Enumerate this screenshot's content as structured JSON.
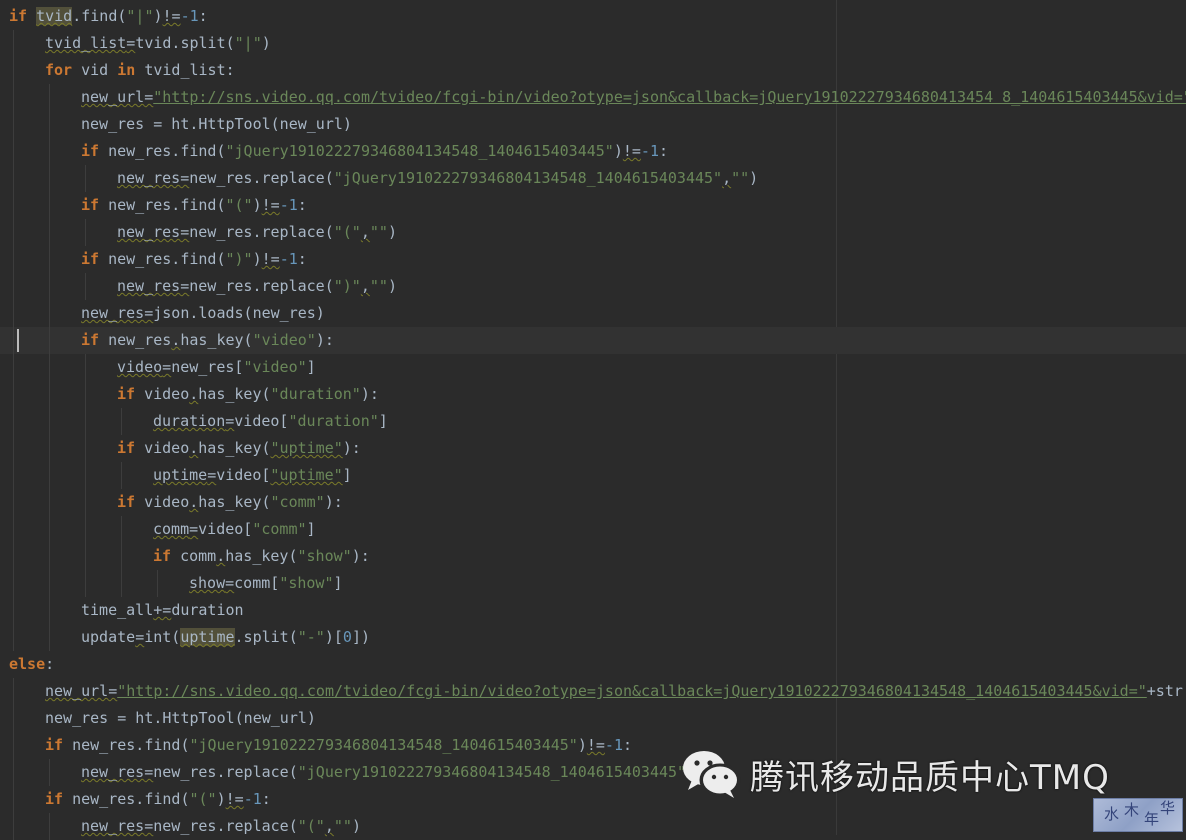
{
  "editor": {
    "caret_line": 12,
    "lines": [
      {
        "indent": 0,
        "tokens": [
          [
            "kw",
            "if"
          ],
          [
            "op",
            " "
          ],
          [
            "hl wav",
            "tvid"
          ],
          [
            "op",
            ".find("
          ],
          [
            "str",
            "\"|\""
          ],
          [
            "op",
            ")"
          ],
          [
            "wav",
            "!="
          ],
          [
            "num",
            "-1"
          ],
          [
            "op",
            ":"
          ]
        ]
      },
      {
        "indent": 1,
        "tokens": [
          [
            "wav",
            "tvid_list"
          ],
          [
            "wav",
            "="
          ],
          [
            "op",
            "tvid.split("
          ],
          [
            "str",
            "\"|\""
          ],
          [
            "op",
            ")"
          ]
        ]
      },
      {
        "indent": 1,
        "tokens": [
          [
            "kw",
            "for"
          ],
          [
            "op",
            " vid "
          ],
          [
            "kw",
            "in"
          ],
          [
            "op",
            " tvid_list:"
          ]
        ]
      },
      {
        "indent": 2,
        "tokens": [
          [
            "wav",
            "new_url"
          ],
          [
            "wav",
            "="
          ],
          [
            "str link",
            "\"http://sns.video.qq.com/tvideo/fcgi-bin/video?otype=json&callback=jQuery19102227934680413454 8_1404615403445&vid=\""
          ],
          [
            "op",
            "+"
          ]
        ]
      },
      {
        "indent": 2,
        "tokens": [
          [
            "op",
            "new_res = ht.HttpTool(new_url)"
          ]
        ]
      },
      {
        "indent": 2,
        "tokens": [
          [
            "kw",
            "if"
          ],
          [
            "op",
            " new_res.find("
          ],
          [
            "str",
            "\"jQuery191022279346804134548_1404615403445\""
          ],
          [
            "op",
            ")"
          ],
          [
            "wav",
            "!="
          ],
          [
            "num",
            "-1"
          ],
          [
            "op",
            ":"
          ]
        ]
      },
      {
        "indent": 3,
        "tokens": [
          [
            "wav",
            "new_res"
          ],
          [
            "wav",
            "="
          ],
          [
            "op",
            "new_res.replace("
          ],
          [
            "str",
            "\"jQuery191022279346804134548_1404615403445\""
          ],
          [
            "wav",
            ","
          ],
          [
            "str",
            "\"\""
          ],
          [
            "op",
            ")"
          ]
        ]
      },
      {
        "indent": 2,
        "tokens": [
          [
            "kw",
            "if"
          ],
          [
            "op",
            " new_res.find("
          ],
          [
            "str",
            "\"(\""
          ],
          [
            "op",
            ")"
          ],
          [
            "wav",
            "!="
          ],
          [
            "num",
            "-1"
          ],
          [
            "op",
            ":"
          ]
        ]
      },
      {
        "indent": 3,
        "tokens": [
          [
            "wav",
            "new_res"
          ],
          [
            "wav",
            "="
          ],
          [
            "op",
            "new_res.replace("
          ],
          [
            "str",
            "\"(\""
          ],
          [
            "wav",
            ","
          ],
          [
            "str",
            "\"\""
          ],
          [
            "op",
            ")"
          ]
        ]
      },
      {
        "indent": 2,
        "tokens": [
          [
            "kw",
            "if"
          ],
          [
            "op",
            " new_res.find("
          ],
          [
            "str",
            "\")\""
          ],
          [
            "op",
            ")"
          ],
          [
            "wav",
            "!="
          ],
          [
            "num",
            "-1"
          ],
          [
            "op",
            ":"
          ]
        ]
      },
      {
        "indent": 3,
        "tokens": [
          [
            "wav",
            "new_res"
          ],
          [
            "wav",
            "="
          ],
          [
            "op",
            "new_res.replace("
          ],
          [
            "str",
            "\")\""
          ],
          [
            "wav",
            ","
          ],
          [
            "str",
            "\"\""
          ],
          [
            "op",
            ")"
          ]
        ]
      },
      {
        "indent": 2,
        "tokens": [
          [
            "wav",
            "new_res"
          ],
          [
            "wav",
            "="
          ],
          [
            "op",
            "json.loads(new_res)"
          ]
        ]
      },
      {
        "indent": 2,
        "tokens": [
          [
            "kw",
            "if"
          ],
          [
            "op",
            " new_res"
          ],
          [
            "wav",
            "."
          ],
          [
            "op",
            "has_key("
          ],
          [
            "str",
            "\"video\""
          ],
          [
            "op",
            "):"
          ]
        ]
      },
      {
        "indent": 3,
        "tokens": [
          [
            "wav",
            "video"
          ],
          [
            "wav",
            "="
          ],
          [
            "op",
            "new_res["
          ],
          [
            "str",
            "\"video\""
          ],
          [
            "op",
            "]"
          ]
        ]
      },
      {
        "indent": 3,
        "tokens": [
          [
            "kw",
            "if"
          ],
          [
            "op",
            " video"
          ],
          [
            "wav",
            "."
          ],
          [
            "op",
            "has_key("
          ],
          [
            "str",
            "\"duration\""
          ],
          [
            "op",
            "):"
          ]
        ]
      },
      {
        "indent": 4,
        "tokens": [
          [
            "wav",
            "duration"
          ],
          [
            "wav",
            "="
          ],
          [
            "op",
            "video["
          ],
          [
            "str",
            "\"duration\""
          ],
          [
            "op",
            "]"
          ]
        ]
      },
      {
        "indent": 3,
        "tokens": [
          [
            "kw",
            "if"
          ],
          [
            "op",
            " video"
          ],
          [
            "wav",
            "."
          ],
          [
            "op",
            "has_key("
          ],
          [
            "str wav",
            "\"uptime\""
          ],
          [
            "op",
            "):"
          ]
        ]
      },
      {
        "indent": 4,
        "tokens": [
          [
            "wav",
            "uptime"
          ],
          [
            "wav",
            "="
          ],
          [
            "op",
            "video["
          ],
          [
            "str wav",
            "\"uptime\""
          ],
          [
            "op",
            "]"
          ]
        ]
      },
      {
        "indent": 3,
        "tokens": [
          [
            "kw",
            "if"
          ],
          [
            "op",
            " video"
          ],
          [
            "wav",
            "."
          ],
          [
            "op",
            "has_key("
          ],
          [
            "str",
            "\"comm\""
          ],
          [
            "op",
            "):"
          ]
        ]
      },
      {
        "indent": 4,
        "tokens": [
          [
            "wav",
            "comm"
          ],
          [
            "wav",
            "="
          ],
          [
            "op",
            "video["
          ],
          [
            "str",
            "\"comm\""
          ],
          [
            "op",
            "]"
          ]
        ]
      },
      {
        "indent": 4,
        "tokens": [
          [
            "kw",
            "if"
          ],
          [
            "op",
            " comm"
          ],
          [
            "wav",
            "."
          ],
          [
            "op",
            "has_key("
          ],
          [
            "str",
            "\"show\""
          ],
          [
            "op",
            "):"
          ]
        ]
      },
      {
        "indent": 5,
        "tokens": [
          [
            "wav",
            "show"
          ],
          [
            "wav",
            "="
          ],
          [
            "op",
            "comm["
          ],
          [
            "str",
            "\"show\""
          ],
          [
            "op",
            "]"
          ]
        ]
      },
      {
        "indent": 2,
        "tokens": [
          [
            "op",
            "time_all"
          ],
          [
            "wav",
            "+="
          ],
          [
            "op",
            "duration"
          ]
        ]
      },
      {
        "indent": 2,
        "tokens": [
          [
            "op",
            "update"
          ],
          [
            "wav",
            "="
          ],
          [
            "op",
            "int("
          ],
          [
            "hl wav",
            "uptime"
          ],
          [
            "op",
            ".split("
          ],
          [
            "str",
            "\"-\""
          ],
          [
            "op",
            ")["
          ],
          [
            "num",
            "0"
          ],
          [
            "op",
            "])"
          ]
        ]
      },
      {
        "indent": 0,
        "tokens": [
          [
            "kw",
            "else"
          ],
          [
            "op",
            ":"
          ]
        ]
      },
      {
        "indent": 1,
        "tokens": [
          [
            "wav",
            "new_url"
          ],
          [
            "wav",
            "="
          ],
          [
            "str link",
            "\"http://sns.video.qq.com/tvideo/fcgi-bin/video?otype=json&callback=jQuery191022279346804134548_1404615403445&vid=\""
          ],
          [
            "op",
            "+str("
          ]
        ]
      },
      {
        "indent": 1,
        "tokens": [
          [
            "op",
            "new_res = ht.HttpTool(new_url)"
          ]
        ]
      },
      {
        "indent": 1,
        "tokens": [
          [
            "kw",
            "if"
          ],
          [
            "op",
            " new_res.find("
          ],
          [
            "str",
            "\"jQuery191022279346804134548_1404615403445\""
          ],
          [
            "op",
            ")"
          ],
          [
            "wav",
            "!="
          ],
          [
            "num",
            "-1"
          ],
          [
            "op",
            ":"
          ]
        ]
      },
      {
        "indent": 2,
        "tokens": [
          [
            "wav",
            "new_res"
          ],
          [
            "wav",
            "="
          ],
          [
            "op",
            "new_res.replace("
          ],
          [
            "str",
            "\"jQuery191022279346804134548_1404615403445\""
          ]
        ]
      },
      {
        "indent": 1,
        "tokens": [
          [
            "kw",
            "if"
          ],
          [
            "op",
            " new_res.find("
          ],
          [
            "str",
            "\"(\""
          ],
          [
            "op",
            ")"
          ],
          [
            "wav",
            "!="
          ],
          [
            "num",
            "-1"
          ],
          [
            "op",
            ":"
          ]
        ]
      },
      {
        "indent": 2,
        "tokens": [
          [
            "wav",
            "new_res"
          ],
          [
            "wav",
            "="
          ],
          [
            "op",
            "new_res.replace("
          ],
          [
            "str",
            "\"(\""
          ],
          [
            "wav",
            ","
          ],
          [
            "str",
            "\"\""
          ],
          [
            "op",
            ")"
          ]
        ]
      }
    ]
  },
  "watermark": {
    "text": "腾讯移动品质中心TMQ",
    "logo_icon": "wechat-logo-icon"
  },
  "stamp": {
    "chars": [
      "水",
      "木",
      "年",
      "华"
    ]
  },
  "colors": {
    "background": "#2b2b2b",
    "keyword": "#cc7832",
    "string": "#6a8759",
    "number": "#6897bb",
    "text": "#a9b7c6"
  }
}
